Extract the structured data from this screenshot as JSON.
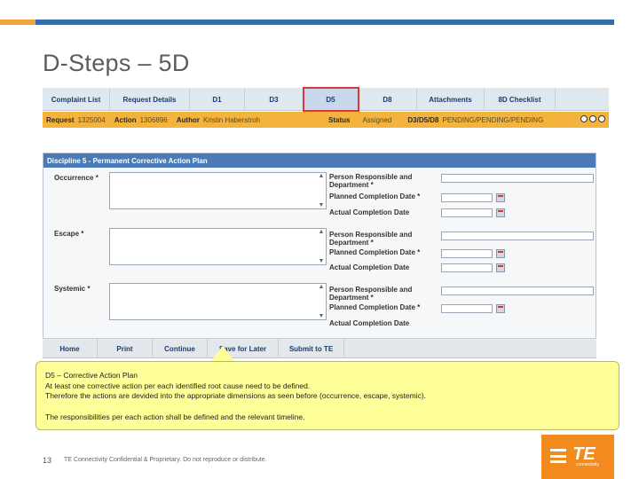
{
  "slide": {
    "title": "D-Steps – 5D",
    "page_number": "13",
    "footer": "TE Connectivity Confidential & Proprietary. Do not reproduce or distribute.",
    "logo_text": "TE",
    "logo_subtext": "connectivity",
    "accent_orange": "#f28a1e",
    "accent_blue": "#2f6fb0"
  },
  "tabs": [
    {
      "label": "Complaint List",
      "active": false
    },
    {
      "label": "Request Details",
      "active": false
    },
    {
      "label": "D1",
      "active": false
    },
    {
      "label": "D3",
      "active": false
    },
    {
      "label": "D5",
      "active": true
    },
    {
      "label": "D8",
      "active": false
    },
    {
      "label": "Attachments",
      "active": false
    },
    {
      "label": "8D Checklist",
      "active": false
    }
  ],
  "status_bar": {
    "request_label": "Request",
    "request_value": "1325004",
    "action_label": "Action",
    "action_value": "1306896",
    "author_label": "Author",
    "author_value": "Kristin Haberstroh",
    "status_label": "Status",
    "status_value": "Assigned",
    "steps_label": "D3/D5/D8",
    "steps_value": "PENDING/PENDING/PENDING"
  },
  "panel": {
    "header": "Discipline 5 - Permanent Corrective Action Plan",
    "person_label": "Person Responsible and Department *",
    "planned_label": "Planned Completion Date *",
    "actual_label": "Actual Completion Date",
    "rows": [
      {
        "label": "Occurrence *"
      },
      {
        "label": "Escape *"
      },
      {
        "label": "Systemic *"
      }
    ]
  },
  "actions": [
    {
      "label": "Home"
    },
    {
      "label": "Print"
    },
    {
      "label": "Continue"
    },
    {
      "label": "Save for Later"
    },
    {
      "label": "Submit to TE"
    }
  ],
  "callout": {
    "line1": "D5 – Corrective Action Plan",
    "line2": "At least one corrective action per each identified root cause need to be defined.",
    "line3": "Therefore the actions are devided into the appropriate dimensions as seen before (occurrence, escape, systemic).",
    "line4": "The responsibilities per each action shall be defined and the relevant timeline."
  }
}
